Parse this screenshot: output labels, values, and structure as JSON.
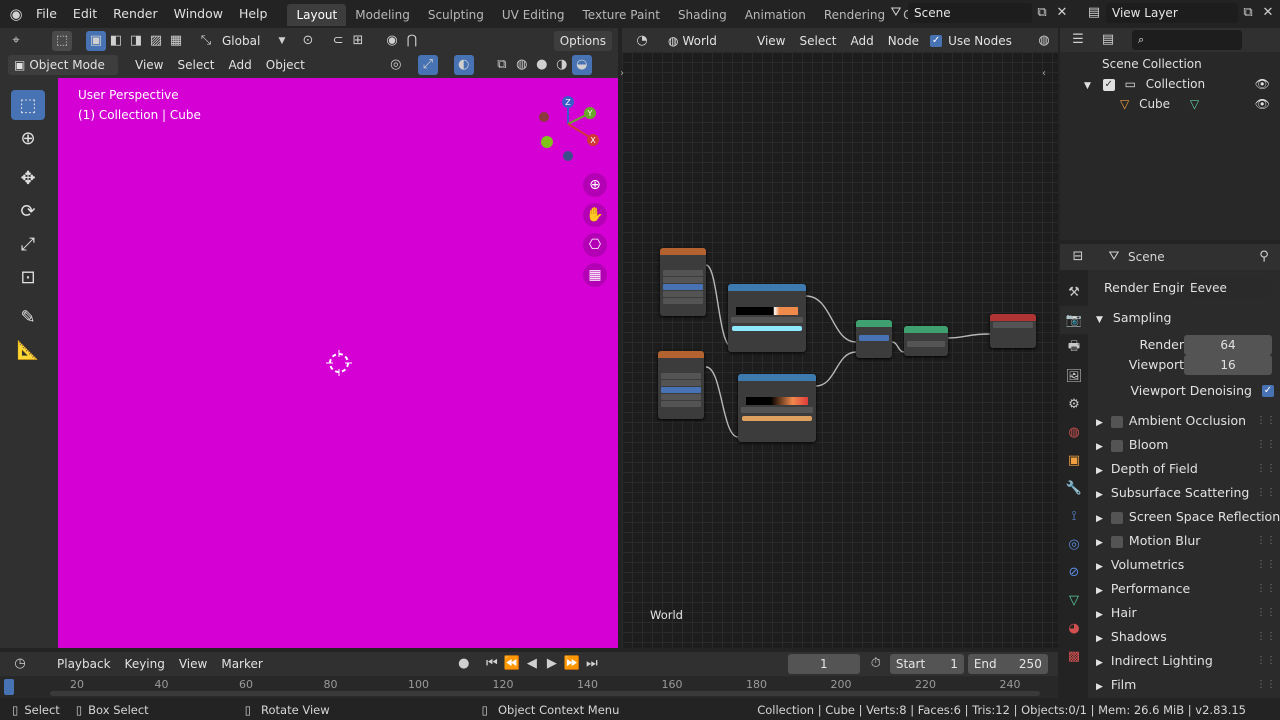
{
  "topbar": {
    "menus": [
      "File",
      "Edit",
      "Render",
      "Window",
      "Help"
    ],
    "workspaces": [
      "Layout",
      "Modeling",
      "Sculpting",
      "UV Editing",
      "Texture Paint",
      "Shading",
      "Animation",
      "Rendering",
      "Compositing"
    ],
    "active_workspace": "Layout",
    "scene_name": "Scene",
    "view_layer": "View Layer"
  },
  "viewport_header": {
    "transform_orientation": "Global",
    "options_label": "Options",
    "mode": "Object Mode",
    "menus": [
      "View",
      "Select",
      "Add",
      "Object"
    ]
  },
  "viewport": {
    "perspective_label": "User Perspective",
    "collection_label": "(1) Collection | Cube",
    "background_color": "#d400d4"
  },
  "node_editor": {
    "shader_type": "World",
    "menus": [
      "View",
      "Select",
      "Add",
      "Node"
    ],
    "use_nodes_label": "Use Nodes",
    "context_label": "World"
  },
  "outliner": {
    "search_placeholder": "",
    "scene_collection": "Scene Collection",
    "collection": "Collection",
    "object": "Cube"
  },
  "properties": {
    "context": "Scene",
    "render_engine_label": "Render Engine",
    "render_engine": "Eevee",
    "sampling_label": "Sampling",
    "render_label": "Render",
    "render_samples": "64",
    "viewport_label": "Viewport",
    "viewport_samples": "16",
    "viewport_denoising": "Viewport Denoising",
    "panels": [
      {
        "label": "Ambient Occlusion",
        "checkbox": true
      },
      {
        "label": "Bloom",
        "checkbox": true
      },
      {
        "label": "Depth of Field",
        "checkbox": false
      },
      {
        "label": "Subsurface Scattering",
        "checkbox": false
      },
      {
        "label": "Screen Space Reflections",
        "checkbox": true
      },
      {
        "label": "Motion Blur",
        "checkbox": true
      },
      {
        "label": "Volumetrics",
        "checkbox": false
      },
      {
        "label": "Performance",
        "checkbox": false
      },
      {
        "label": "Hair",
        "checkbox": false
      },
      {
        "label": "Shadows",
        "checkbox": false
      },
      {
        "label": "Indirect Lighting",
        "checkbox": false
      },
      {
        "label": "Film",
        "checkbox": false
      }
    ]
  },
  "timeline": {
    "menus": [
      "Playback",
      "Keying",
      "View",
      "Marker"
    ],
    "current_frame": "1",
    "start_label": "Start",
    "start": "1",
    "end_label": "End",
    "end": "250",
    "ruler": [
      "20",
      "40",
      "60",
      "80",
      "100",
      "120",
      "140",
      "160",
      "180",
      "200",
      "220",
      "240"
    ]
  },
  "statusbar": {
    "select": "Select",
    "box_select": "Box Select",
    "rotate_view": "Rotate View",
    "context_menu": "Object Context Menu",
    "stats": "Collection | Cube | Verts:8 | Faces:6 | Tris:12 | Objects:0/1 | Mem: 26.6 MiB | v2.83.15"
  },
  "colors": {
    "accent": "#4772b3",
    "selection": "#4772b3"
  }
}
